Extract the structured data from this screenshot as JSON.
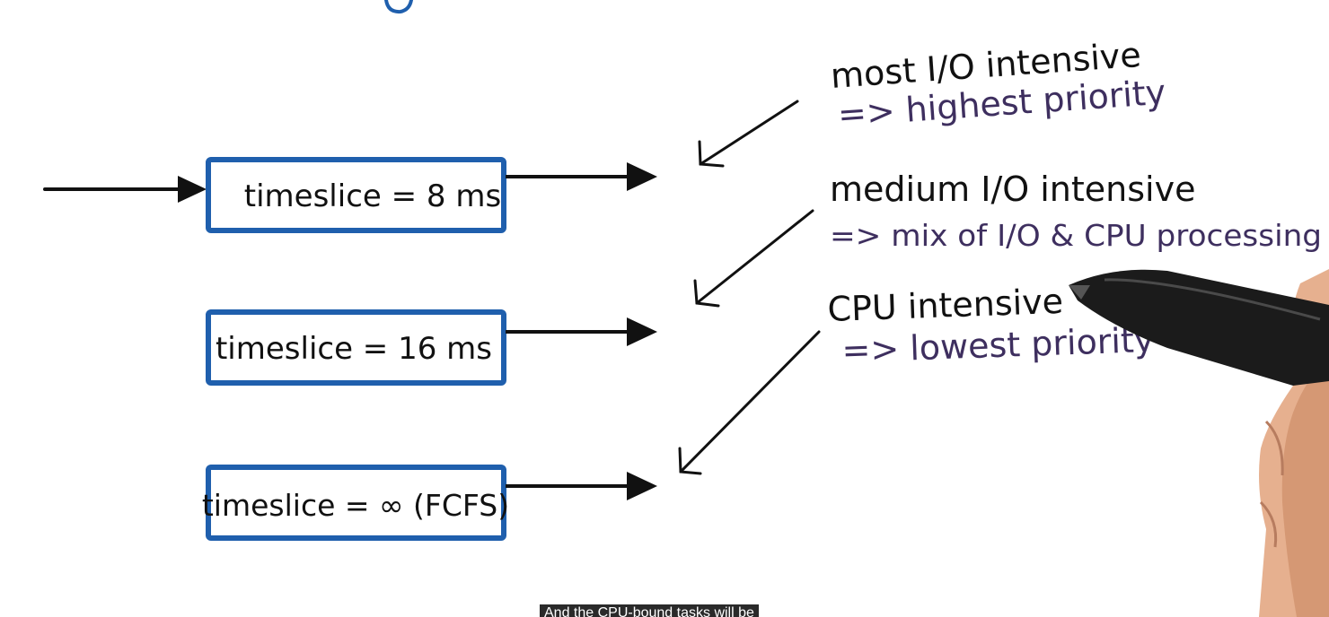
{
  "colors": {
    "box_border": "#1f5fad",
    "ink_black": "#111111",
    "ink_purple": "#3e2f5f",
    "caption_bg": "#2a2a2a",
    "caption_text": "#ffffff"
  },
  "queues": [
    {
      "label": "timeslice = 8 ms"
    },
    {
      "label": "timeslice = 16 ms"
    },
    {
      "label": "timeslice = ∞ (FCFS)"
    }
  ],
  "annotations": [
    {
      "title": "most I/O intensive",
      "detail": "=> highest priority"
    },
    {
      "title": "medium I/O intensive",
      "detail": "=> mix of I/O & CPU processing"
    },
    {
      "title": "CPU intensive",
      "detail": "=> lowest priority"
    }
  ],
  "caption": "And the CPU-bound tasks will be"
}
